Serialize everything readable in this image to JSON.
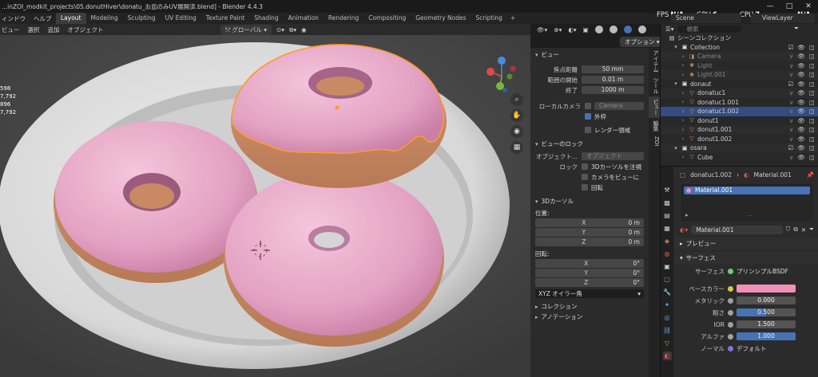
{
  "window": {
    "title": "...inZOI_modkit_projects\\05.donutHiver\\donatu_お皿のみUV展開済.blend] - Blender 4.4.3",
    "minimize": "—",
    "maximize": "□",
    "close": "✕"
  },
  "menu": [
    "ィンドウ",
    "ヘルプ"
  ],
  "workspaces": [
    {
      "label": "Layout",
      "active": true
    },
    {
      "label": "Modeling",
      "active": false
    },
    {
      "label": "Sculpting",
      "active": false
    },
    {
      "label": "UV Editing",
      "active": false
    },
    {
      "label": "Texture Paint",
      "active": false
    },
    {
      "label": "Shading",
      "active": false
    },
    {
      "label": "Animation",
      "active": false
    },
    {
      "label": "Rendering",
      "active": false
    },
    {
      "label": "Compositing",
      "active": false
    },
    {
      "label": "Geometry Nodes",
      "active": false
    },
    {
      "label": "Scripting",
      "active": false
    }
  ],
  "workspace_add": "+",
  "stats": {
    "fps_label": "FPS",
    "fps_value": "N/A",
    "gpu_label": "GPU",
    "gpu_value": "6",
    "cpu_label": "CPU",
    "cpu_value": "7",
    "extra_value": "N/A"
  },
  "scene": {
    "name": "Scene",
    "view_layer": "ViewLayer"
  },
  "viewport_header": {
    "menu": [
      "ビュー",
      "選択",
      "追加",
      "オブジェクト"
    ],
    "orientation": "グローバル",
    "options": "オプション"
  },
  "viewport_stats": [
    "598",
    "7,792",
    "896",
    "7,792"
  ],
  "npanel": {
    "view_title": "ビュー",
    "focal_length_label": "焦点距離",
    "focal_length": "50 mm",
    "clip_start_label": "範囲の開始",
    "clip_start": "0.01 m",
    "clip_end_label": "終了",
    "clip_end": "1000 m",
    "local_camera_label": "ローカルカメラ",
    "local_camera_placeholder": "Camera",
    "outer_label": "外枠",
    "render_region_label": "レンダー領域",
    "view_lock_title": "ビューのロック",
    "object_label": "オブジェクト...",
    "object_placeholder": "オブジェクト",
    "lock_label": "ロック",
    "lock_3d_cursor": "3Dカーソルを注視",
    "lock_camera": "カメラをビューに",
    "lock_rotation": "回転",
    "cursor_title": "3Dカーソル",
    "location_label": "位置:",
    "rotation_label": "回転:",
    "loc": [
      {
        "axis": "X",
        "value": "0 m"
      },
      {
        "axis": "Y",
        "value": "0 m"
      },
      {
        "axis": "Z",
        "value": "0 m"
      }
    ],
    "rot": [
      {
        "axis": "X",
        "value": "0°"
      },
      {
        "axis": "Y",
        "value": "0°"
      },
      {
        "axis": "Z",
        "value": "0°"
      }
    ],
    "rotation_mode": "XYZ オイラー角",
    "collection_title": "コレクション",
    "annotation_title": "アノテーション"
  },
  "sidebar_tabs": [
    "アイテム",
    "ツール",
    "ビュー",
    "編集",
    "ZOI"
  ],
  "outliner": {
    "search_placeholder": "検索",
    "scene_collection": "シーンコレクション",
    "rows": [
      {
        "label": "Collection",
        "indent": 1,
        "type": "collection",
        "dim": false
      },
      {
        "label": "Camera",
        "indent": 2,
        "type": "camera",
        "dim": true
      },
      {
        "label": "Light",
        "indent": 2,
        "type": "light",
        "dim": true
      },
      {
        "label": "Light.001",
        "indent": 2,
        "type": "light",
        "dim": true
      },
      {
        "label": "donaut",
        "indent": 1,
        "type": "collection",
        "dim": false
      },
      {
        "label": "donatuc1",
        "indent": 2,
        "type": "mesh",
        "dim": false
      },
      {
        "label": "donatuc1.001",
        "indent": 2,
        "type": "mesh",
        "dim": false
      },
      {
        "label": "donatuc1.002",
        "indent": 2,
        "type": "mesh",
        "dim": false,
        "selected": true
      },
      {
        "label": "donut1",
        "indent": 2,
        "type": "mesh",
        "dim": false
      },
      {
        "label": "donut1.001",
        "indent": 2,
        "type": "mesh",
        "dim": false
      },
      {
        "label": "donut1.002",
        "indent": 2,
        "type": "mesh",
        "dim": false
      },
      {
        "label": "osara",
        "indent": 1,
        "type": "collection",
        "dim": false
      },
      {
        "label": "Cube",
        "indent": 2,
        "type": "mesh",
        "dim": false
      }
    ]
  },
  "properties": {
    "object_name": "donatuc1.002",
    "material_name": "Material.001",
    "slot": "Material.001",
    "preview_title": "プレビュー",
    "surface_title": "サーフェス",
    "surface_label": "サーフェス",
    "surface_value": "プリンシプルBSDF",
    "base_color_label": "ベースカラー",
    "base_color": "#f090b8",
    "metallic_label": "メタリック",
    "metallic": "0.000",
    "metallic_frac": 0.0,
    "roughness_label": "粗さ",
    "roughness": "0.500",
    "roughness_frac": 0.5,
    "ior_label": "IOR",
    "ior": "1.500",
    "ior_frac": 0.0,
    "alpha_label": "アルファ",
    "alpha": "1.000",
    "alpha_frac": 1.0,
    "normal_label": "ノーマル",
    "normal_value": "デフォルト"
  },
  "colors": {
    "accent": "#4772b3",
    "selection": "#ff9a2e",
    "icing": "#e7a6c6",
    "dough": "#c98a63",
    "plate": "#dcdcdc"
  }
}
